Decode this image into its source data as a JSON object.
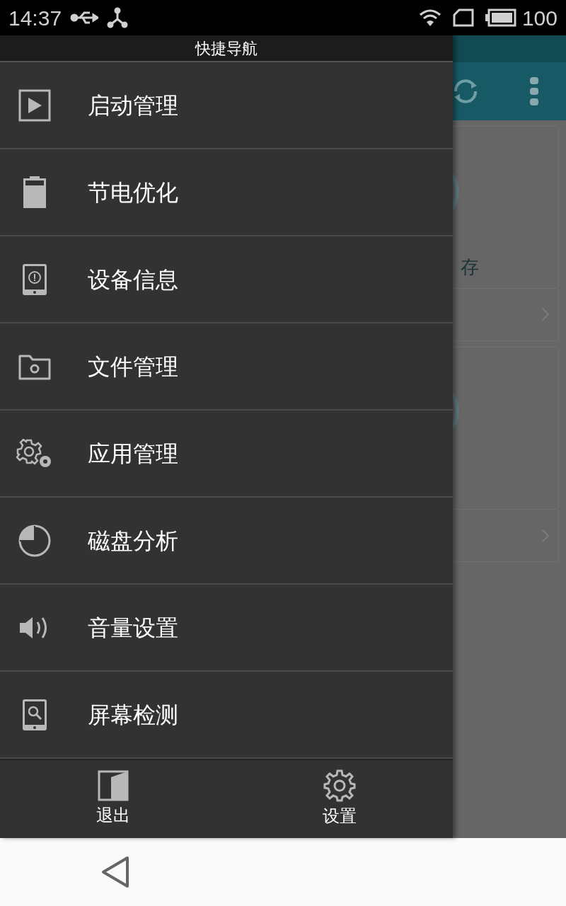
{
  "status_bar": {
    "time": "14:37",
    "battery": "100"
  },
  "drawer": {
    "title": "快捷导航",
    "items": [
      {
        "label": "启动管理",
        "kind": "play"
      },
      {
        "label": "节电优化",
        "kind": "battery"
      },
      {
        "label": "设备信息",
        "kind": "tablet-info"
      },
      {
        "label": "文件管理",
        "kind": "folder"
      },
      {
        "label": "应用管理",
        "kind": "gears"
      },
      {
        "label": "磁盘分析",
        "kind": "pie"
      },
      {
        "label": "音量设置",
        "kind": "speaker"
      },
      {
        "label": "屏幕检测",
        "kind": "tablet-search"
      }
    ],
    "footer": [
      {
        "label": "退出",
        "kind": "exit"
      },
      {
        "label": "设置",
        "kind": "gear"
      }
    ]
  },
  "background_app": {
    "card_texts": [
      "存"
    ]
  }
}
